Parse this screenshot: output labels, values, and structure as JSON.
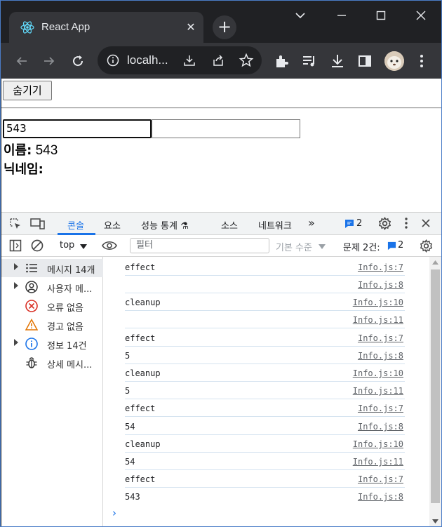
{
  "browser": {
    "tab_title": "React App",
    "url": "localh...",
    "accent": "#35363a"
  },
  "page": {
    "hide_button": "숨기기",
    "input1_value": "543",
    "input2_value": "",
    "name_label": "이름:",
    "name_value": "543",
    "nickname_label": "닉네임:",
    "nickname_value": ""
  },
  "devtools": {
    "tabs": [
      "콘솔",
      "요소",
      "성능 통계 ⚗",
      "소스",
      "네트워크",
      "»"
    ],
    "issues_badge": "2",
    "context": "top",
    "filter_placeholder": "필터",
    "level": "기본 수준",
    "issues_label": "문제 2건:",
    "issues_count": "2",
    "sidebar": [
      {
        "label": "메시지 14개",
        "icon": "list-icon",
        "expandable": true
      },
      {
        "label": "사용자 메...",
        "icon": "user-icon",
        "expandable": true
      },
      {
        "label": "오류 없음",
        "icon": "error-icon",
        "expandable": false
      },
      {
        "label": "경고 없음",
        "icon": "warning-icon",
        "expandable": false
      },
      {
        "label": "정보 14건",
        "icon": "info-icon",
        "expandable": true
      },
      {
        "label": "상세 메시...",
        "icon": "bug-icon",
        "expandable": false
      }
    ],
    "messages": [
      {
        "text": "effect",
        "source": "Info.js:7"
      },
      {
        "text": "",
        "source": "Info.js:8"
      },
      {
        "text": "cleanup",
        "source": "Info.js:10"
      },
      {
        "text": "",
        "source": "Info.js:11"
      },
      {
        "text": "effect",
        "source": "Info.js:7"
      },
      {
        "text": "5",
        "source": "Info.js:8"
      },
      {
        "text": "cleanup",
        "source": "Info.js:10"
      },
      {
        "text": "5",
        "source": "Info.js:11"
      },
      {
        "text": "effect",
        "source": "Info.js:7"
      },
      {
        "text": "54",
        "source": "Info.js:8"
      },
      {
        "text": "cleanup",
        "source": "Info.js:10"
      },
      {
        "text": "54",
        "source": "Info.js:11"
      },
      {
        "text": "effect",
        "source": "Info.js:7"
      },
      {
        "text": "543",
        "source": "Info.js:8"
      }
    ]
  }
}
